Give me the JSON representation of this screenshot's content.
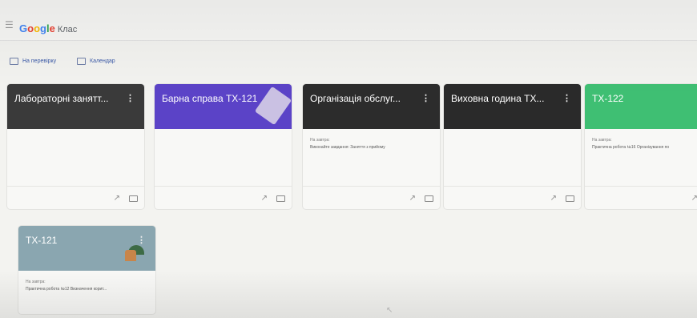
{
  "header": {
    "logo_google": [
      "G",
      "o",
      "o",
      "g",
      "l",
      "e"
    ],
    "logo_product": "Клас"
  },
  "toolbar": {
    "review_label": "На перевірку",
    "calendar_label": "Календар"
  },
  "classes": [
    {
      "title": "Лабораторні занятт...",
      "due_label": "",
      "task": "",
      "color": "#3a3a3a"
    },
    {
      "title": "Барна справа ТХ-121",
      "due_label": "",
      "task": "",
      "color": "#5b43c7"
    },
    {
      "title": "Організація обслуг...",
      "due_label": "На завтра:",
      "task": "Виконайте завдання: Заняття з прийому",
      "color": "#2c2c2c"
    },
    {
      "title": "Виховна година ТХ...",
      "due_label": "",
      "task": "",
      "color": "#2a2a2a"
    },
    {
      "title": "ТХ-122",
      "due_label": "На завтра:",
      "task": "Практична робота №16 Організування по",
      "color": "#3fbf73"
    },
    {
      "title": "ТХ-121",
      "due_label": "На завтра:",
      "task": "Практична робота №12 Визначення корит...",
      "color": "#8aa6b0"
    }
  ],
  "colors": {
    "accent": "#4285f4"
  }
}
